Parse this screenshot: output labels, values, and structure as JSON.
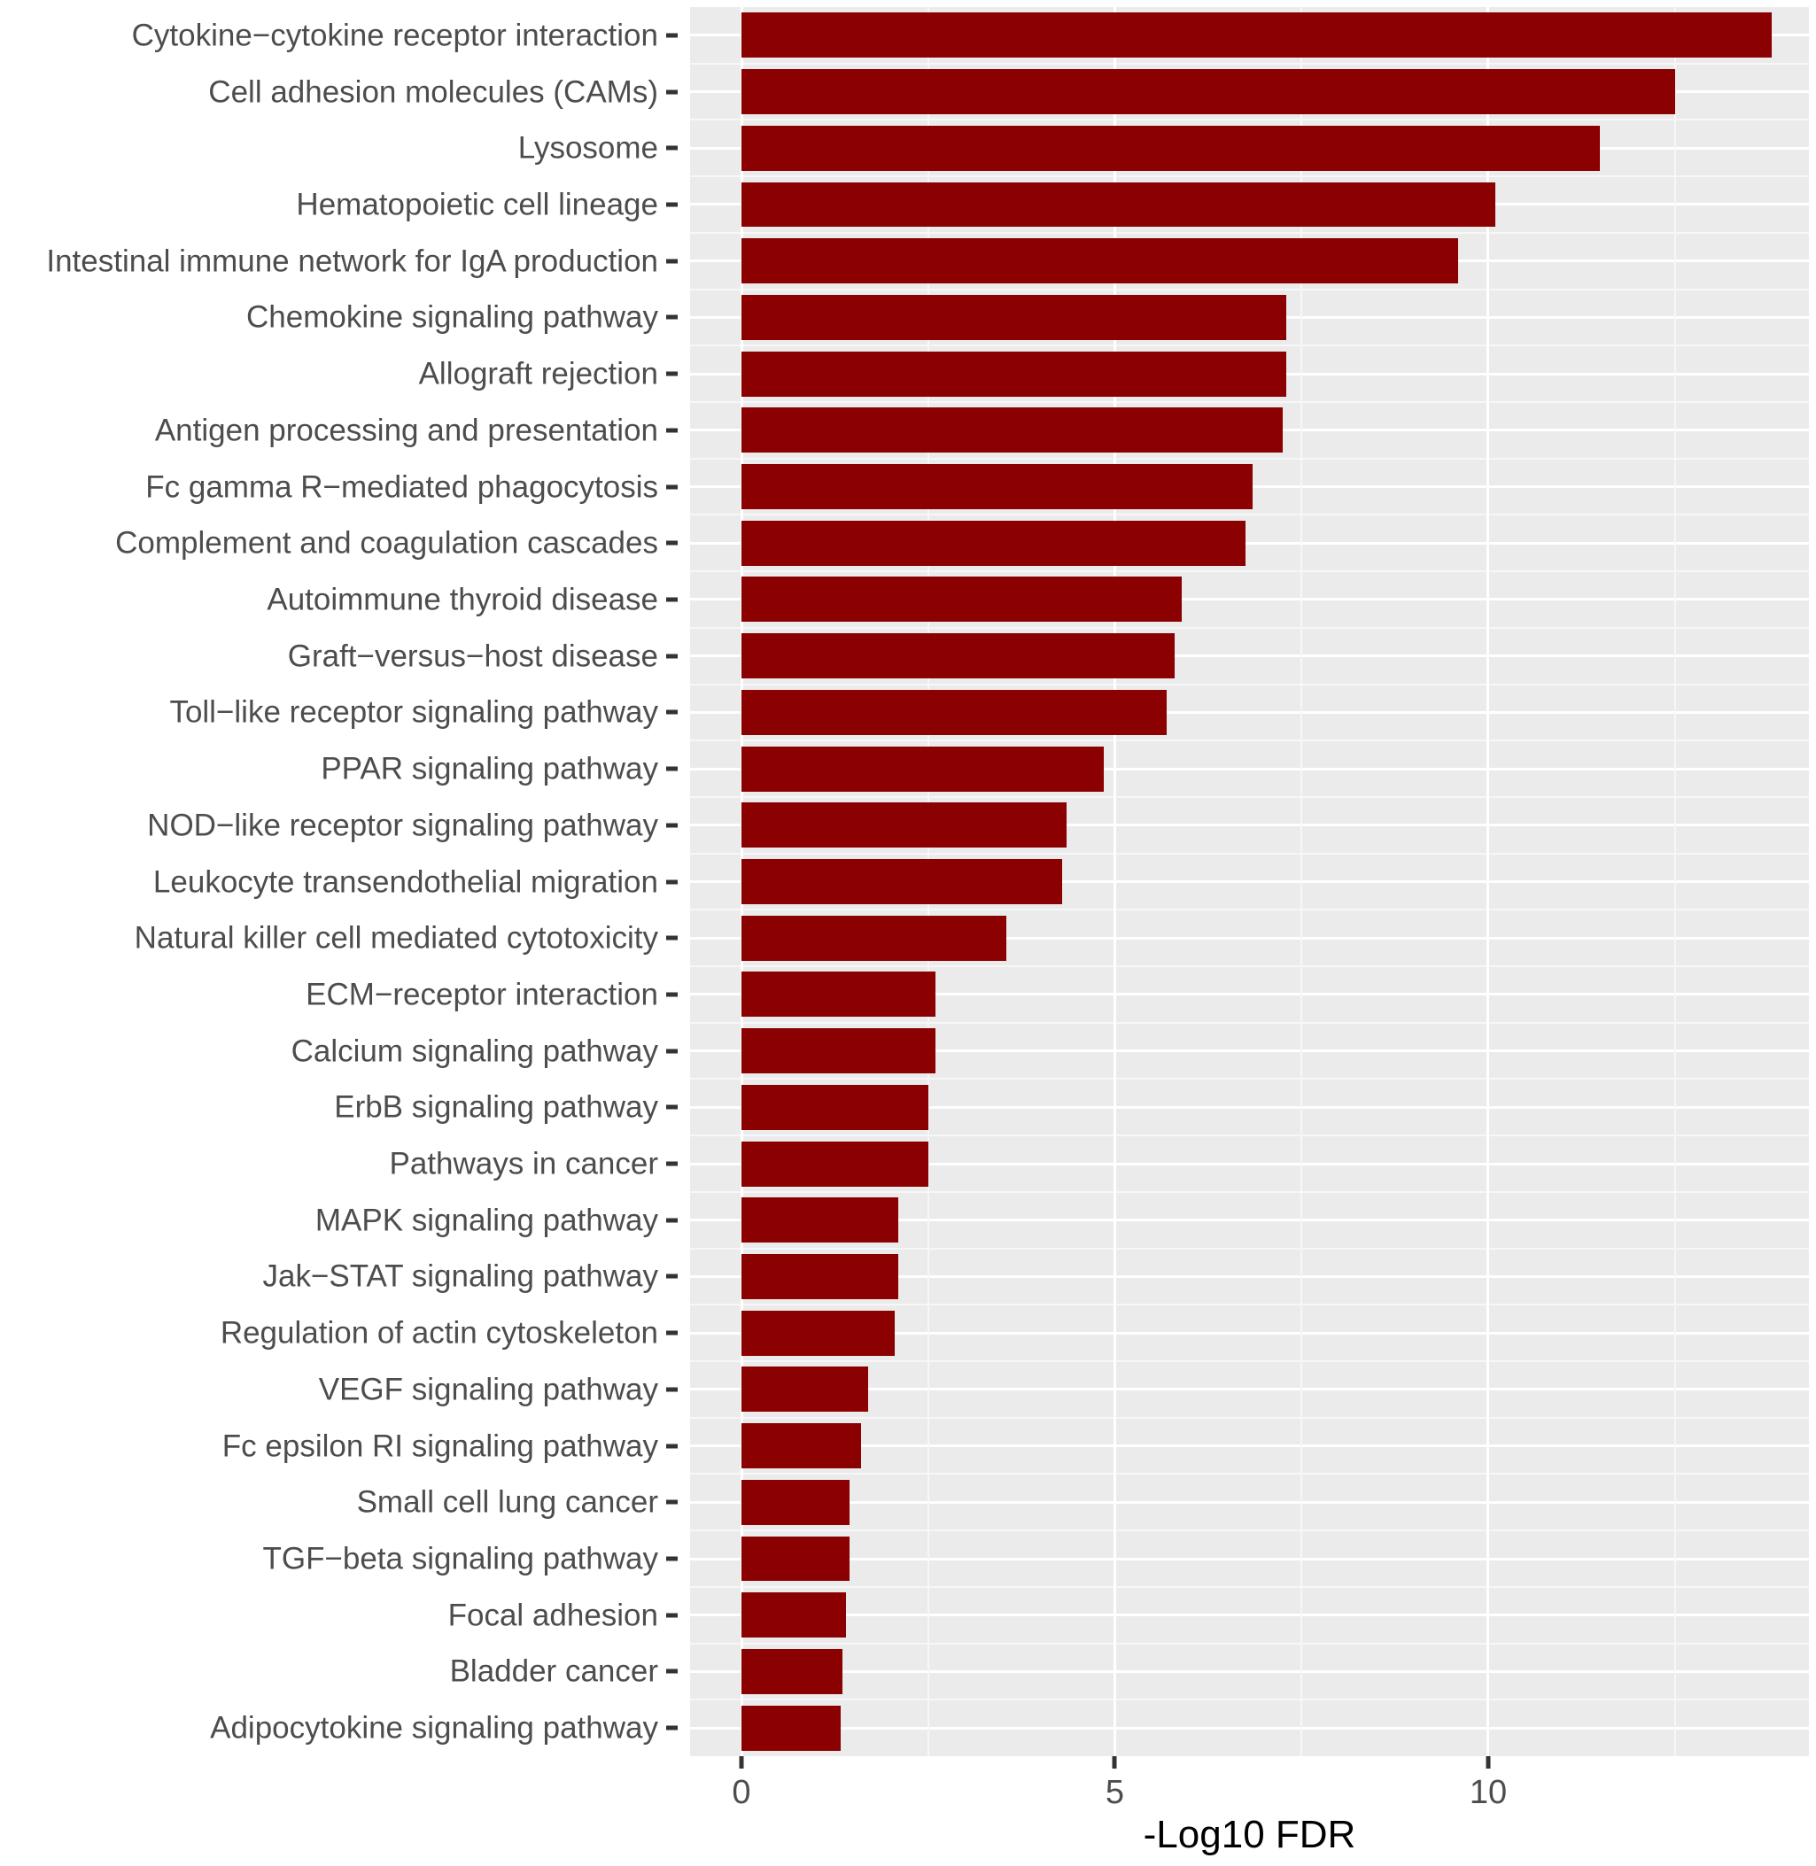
{
  "chart_data": {
    "type": "bar",
    "orientation": "horizontal",
    "title": "",
    "subtitle": "",
    "xlabel": "-Log10 FDR",
    "ylabel": "",
    "xlim": [
      0,
      14.2
    ],
    "xticks": [
      0,
      5,
      10
    ],
    "xtick_labels": [
      "0",
      "5",
      "10"
    ],
    "x_minor_ticks": [
      2.5,
      7.5,
      12.5
    ],
    "grid": true,
    "grid_color": "#ffffff",
    "panel_background": "#ebebeb",
    "bar_color": "#8b0000",
    "legend": "none",
    "categories": [
      "Cytokine−cytokine receptor interaction",
      "Cell adhesion molecules (CAMs)",
      "Lysosome",
      "Hematopoietic cell lineage",
      "Intestinal immune network for IgA production",
      "Chemokine signaling pathway",
      "Allograft rejection",
      "Antigen processing and presentation",
      "Fc gamma R−mediated phagocytosis",
      "Complement and coagulation cascades",
      "Autoimmune thyroid disease",
      "Graft−versus−host disease",
      "Toll−like receptor signaling pathway",
      "PPAR signaling pathway",
      "NOD−like receptor signaling pathway",
      "Leukocyte transendothelial migration",
      "Natural killer cell mediated cytotoxicity",
      "ECM−receptor interaction",
      "Calcium signaling pathway",
      "ErbB signaling pathway",
      "Pathways in cancer",
      "MAPK signaling pathway",
      "Jak−STAT signaling pathway",
      "Regulation of actin cytoskeleton",
      "VEGF signaling pathway",
      "Fc epsilon RI signaling pathway",
      "Small cell lung cancer",
      "TGF−beta signaling pathway",
      "Focal adhesion",
      "Bladder cancer",
      "Adipocytokine signaling pathway"
    ],
    "values": [
      13.8,
      12.5,
      11.5,
      10.1,
      9.6,
      7.3,
      7.3,
      7.25,
      6.85,
      6.75,
      5.9,
      5.8,
      5.7,
      4.85,
      4.35,
      4.3,
      3.55,
      2.6,
      2.6,
      2.5,
      2.5,
      2.1,
      2.1,
      2.05,
      1.7,
      1.6,
      1.45,
      1.45,
      1.4,
      1.35,
      1.33
    ]
  },
  "axis": {
    "x_title": "-Log10 FDR"
  }
}
